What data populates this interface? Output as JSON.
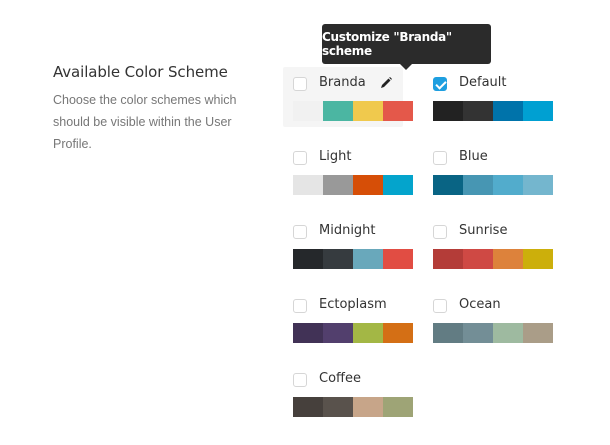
{
  "section": {
    "title": "Available Color Scheme",
    "description": "Choose the color schemes which should be visible within the User Profile."
  },
  "tooltip": {
    "text": "Customize \"Branda\" scheme"
  },
  "schemes": [
    {
      "name": "Branda",
      "checked": false,
      "editable": true,
      "colors": [
        "#f1f1f1",
        "#4bb6a2",
        "#f0c94d",
        "#e4584a"
      ]
    },
    {
      "name": "Default",
      "checked": true,
      "editable": false,
      "colors": [
        "#222222",
        "#333333",
        "#0073aa",
        "#00a0d2"
      ]
    },
    {
      "name": "Light",
      "checked": false,
      "editable": false,
      "colors": [
        "#e5e5e5",
        "#999999",
        "#d64e07",
        "#04a4cc"
      ]
    },
    {
      "name": "Blue",
      "checked": false,
      "editable": false,
      "colors": [
        "#096484",
        "#4796b3",
        "#52accc",
        "#74b6ce"
      ]
    },
    {
      "name": "Midnight",
      "checked": false,
      "editable": false,
      "colors": [
        "#25282b",
        "#363b3f",
        "#69a8bb",
        "#e14d43"
      ]
    },
    {
      "name": "Sunrise",
      "checked": false,
      "editable": false,
      "colors": [
        "#b43c38",
        "#cf4944",
        "#dd823b",
        "#ccaf0b"
      ]
    },
    {
      "name": "Ectoplasm",
      "checked": false,
      "editable": false,
      "colors": [
        "#413256",
        "#523f6d",
        "#a3b745",
        "#d46f15"
      ]
    },
    {
      "name": "Ocean",
      "checked": false,
      "editable": false,
      "colors": [
        "#627c83",
        "#738e96",
        "#9ebaa0",
        "#aa9d88"
      ]
    },
    {
      "name": "Coffee",
      "checked": false,
      "editable": false,
      "colors": [
        "#46403c",
        "#59524c",
        "#c7a589",
        "#9ea476"
      ]
    }
  ]
}
